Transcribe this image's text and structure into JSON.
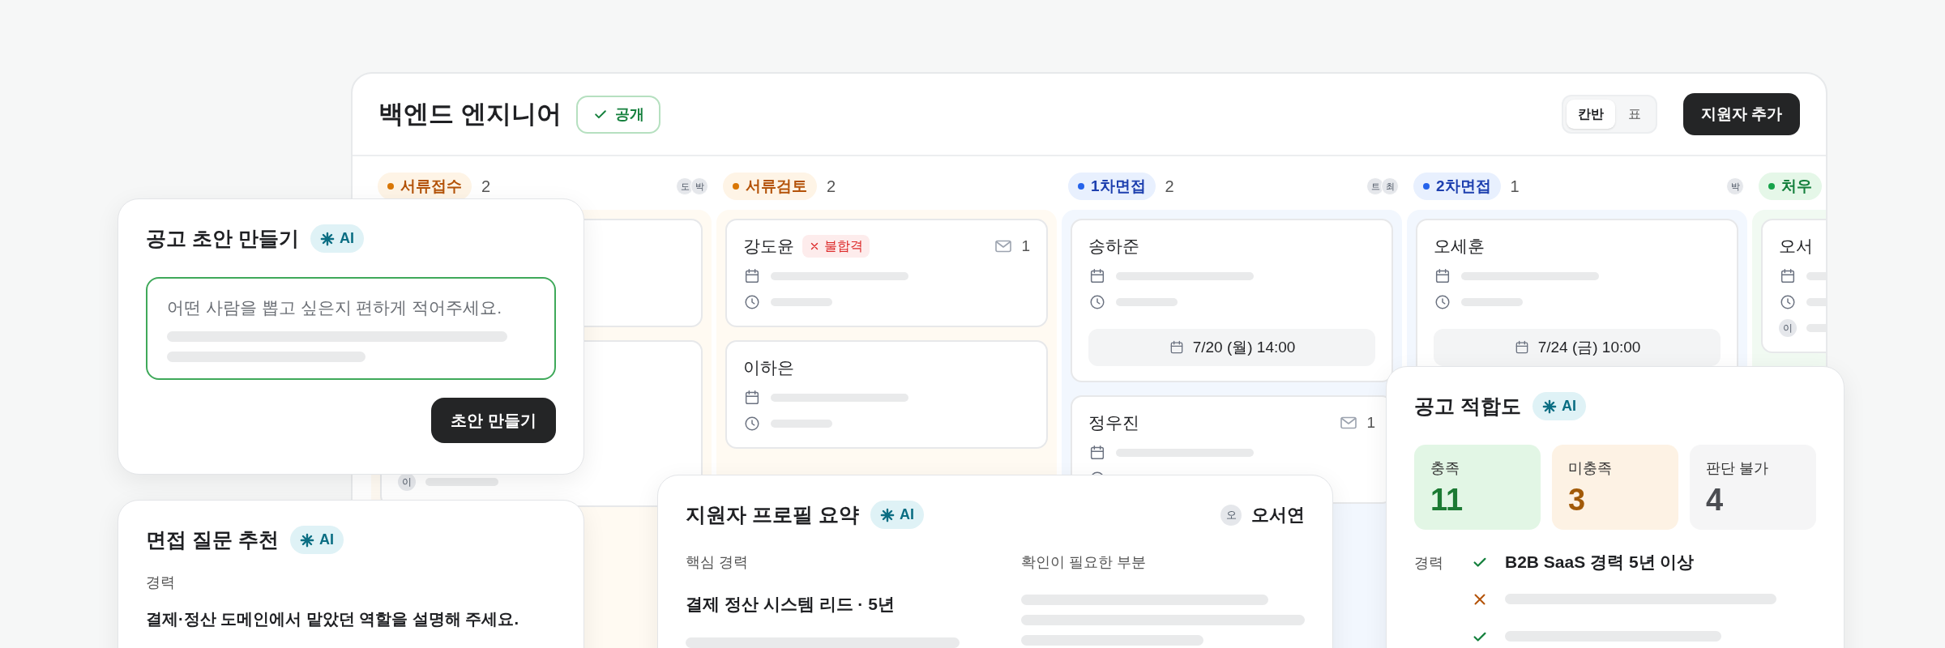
{
  "board": {
    "title": "백엔드 엔지니어",
    "visibility_badge": "공개",
    "view_toggle": [
      {
        "label": "칸반",
        "selected": true
      },
      {
        "label": "표",
        "selected": false
      }
    ],
    "add_button": "지원자 추가",
    "columns": [
      {
        "label": "서류접수",
        "count": "2",
        "color": "#d97706",
        "assignees": [
          "도",
          "박"
        ],
        "cards": [
          {
            "kind": "placeholder"
          },
          {
            "kind": "placeholder",
            "assignee": "이"
          }
        ]
      },
      {
        "label": "서류검토",
        "count": "2",
        "color": "#d97706",
        "cards": [
          {
            "name": "강도윤",
            "status_badge": "불합격",
            "mail_count": "1"
          },
          {
            "name": "이하은"
          }
        ]
      },
      {
        "label": "1차면접",
        "count": "2",
        "color": "#2563eb",
        "assignees": [
          "트",
          "최"
        ],
        "cards": [
          {
            "name": "송하준",
            "interview": "7/20 (월) 14:00"
          },
          {
            "name": "정우진",
            "mail_count": "1"
          }
        ]
      },
      {
        "label": "2차면접",
        "count": "1",
        "color": "#2563eb",
        "assignees": [
          "박"
        ],
        "cards": [
          {
            "name": "오세훈",
            "interview": "7/24 (금) 10:00"
          }
        ]
      },
      {
        "label": "처우",
        "color": "#16a34a",
        "cards": [
          {
            "name": "오서",
            "assignee": "이"
          }
        ]
      }
    ]
  },
  "draft_card": {
    "title": "공고 초안 만들기",
    "ai_badge": "AI",
    "prompt": {
      "placeholder": "어떤 사람을 뽑고 싶은지 편하게 적어주세요."
    },
    "button": "초안 만들기"
  },
  "question_card": {
    "title": "면접 질문 추천",
    "ai_badge": "AI",
    "category": "경력",
    "question": "결제·정산 도메인에서 맡았던 역할을 설명해 주세요."
  },
  "profile_card": {
    "title": "지원자 프로필 요약",
    "ai_badge": "AI",
    "applicant": {
      "initial": "오",
      "name": "오서연"
    },
    "sections": [
      {
        "label": "핵심 경력",
        "value": "결제 정산 시스템 리드 · 5년"
      },
      {
        "label": "확인이 필요한 부분"
      }
    ]
  },
  "fit_card": {
    "title": "공고 적합도",
    "ai_badge": "AI",
    "stats": [
      {
        "kind": "met",
        "label": "충족",
        "value": "11"
      },
      {
        "kind": "unmet",
        "label": "미충족",
        "value": "3"
      },
      {
        "kind": "unknown",
        "label": "판단 불가",
        "value": "4"
      }
    ],
    "category": "경력",
    "criteria": [
      {
        "met": true,
        "text": "B2B SaaS 경력 5년 이상"
      },
      {
        "met": false
      },
      {
        "met": true
      }
    ]
  }
}
